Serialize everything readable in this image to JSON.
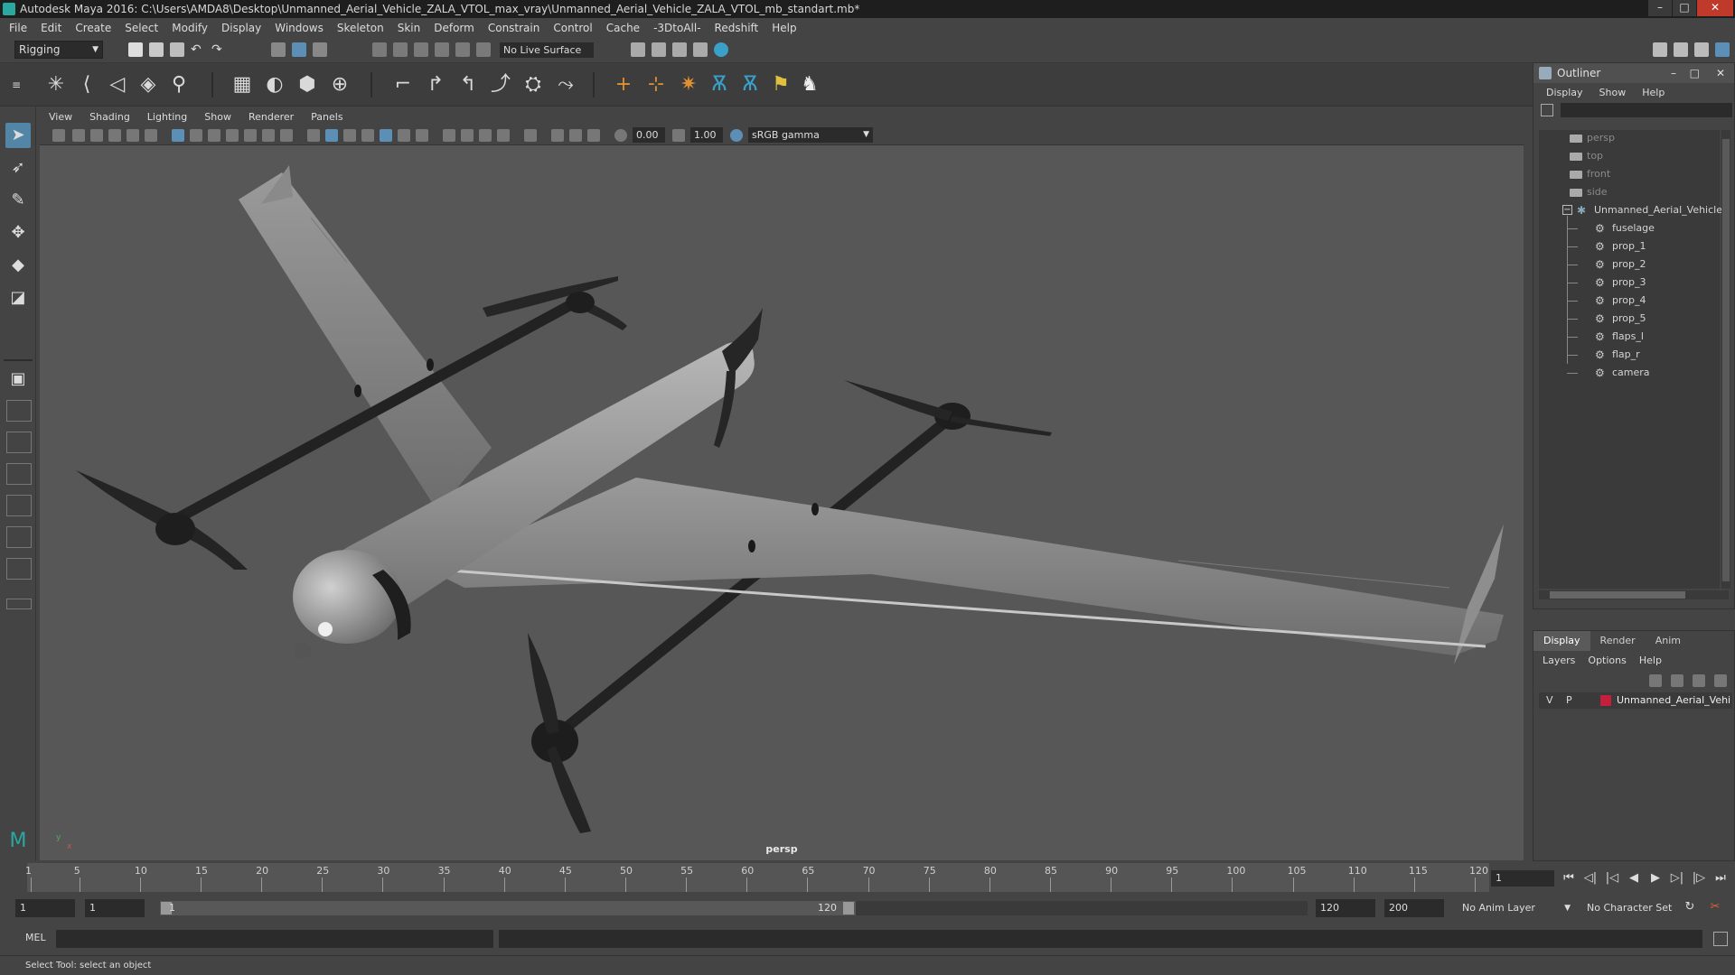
{
  "window": {
    "title": "Autodesk Maya 2016: C:\\Users\\AMDA8\\Desktop\\Unmanned_Aerial_Vehicle_ZALA_VTOL_max_vray\\Unmanned_Aerial_Vehicle_ZALA_VTOL_mb_standart.mb*",
    "minimize": "–",
    "maximize": "□",
    "close": "✕"
  },
  "menubar": [
    "File",
    "Edit",
    "Create",
    "Select",
    "Modify",
    "Display",
    "Windows",
    "Skeleton",
    "Skin",
    "Deform",
    "Constrain",
    "Control",
    "Cache",
    "-3DtoAll-",
    "Redshift",
    "Help"
  ],
  "toolbar": {
    "mode": "Rigging",
    "live_surface": "No Live Surface"
  },
  "viewport": {
    "menu": [
      "View",
      "Shading",
      "Lighting",
      "Show",
      "Renderer",
      "Panels"
    ],
    "exposure": "0.00",
    "gamma": "1.00",
    "color_space": "sRGB gamma",
    "camera": "persp",
    "axis_x": "x",
    "axis_y": "y"
  },
  "outliner": {
    "title": "Outliner",
    "menu": [
      "Display",
      "Show",
      "Help"
    ],
    "cameras": [
      "persp",
      "top",
      "front",
      "side"
    ],
    "group": "Unmanned_Aerial_Vehicle_",
    "children": [
      "fuselage",
      "prop_1",
      "prop_2",
      "prop_3",
      "prop_4",
      "prop_5",
      "flaps_l",
      "flap_r",
      "camera"
    ]
  },
  "layers": {
    "tabs": [
      "Display",
      "Render",
      "Anim"
    ],
    "menu": [
      "Layers",
      "Options",
      "Help"
    ],
    "row": {
      "v": "V",
      "p": "P",
      "name": "Unmanned_Aerial_Vehic",
      "color": "#c41f3b"
    }
  },
  "timeline": {
    "ticks": [
      "1",
      "5",
      "10",
      "15",
      "20",
      "25",
      "30",
      "35",
      "40",
      "45",
      "50",
      "55",
      "60",
      "65",
      "70",
      "75",
      "80",
      "85",
      "90",
      "95",
      "100",
      "105",
      "110",
      "115",
      "120"
    ],
    "current_frame": "1"
  },
  "range": {
    "start": "1",
    "playback_start": "1",
    "slider_start": "1",
    "slider_end": "120",
    "playback_end": "120",
    "end": "200",
    "anim_layer": "No Anim Layer",
    "character_set": "No Character Set"
  },
  "command": {
    "label": "MEL"
  },
  "status": "Select Tool: select an object"
}
